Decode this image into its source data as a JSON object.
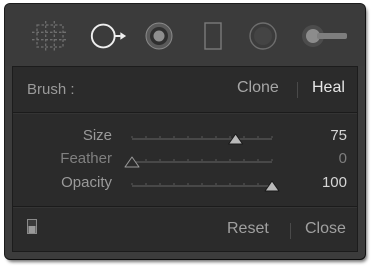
{
  "tools": [
    {
      "name": "crop-overlay",
      "icon": "crop-grid-icon",
      "active": false
    },
    {
      "name": "spot-removal",
      "icon": "spot-removal-icon",
      "active": true
    },
    {
      "name": "red-eye-correction",
      "icon": "red-eye-icon",
      "active": false
    },
    {
      "name": "graduated-filter",
      "icon": "graduated-filter-icon",
      "active": false
    },
    {
      "name": "radial-filter",
      "icon": "radial-filter-icon",
      "active": false
    },
    {
      "name": "adjustment-brush",
      "icon": "adjustment-brush-icon",
      "active": false
    }
  ],
  "brush": {
    "label": "Brush :",
    "options": [
      "Clone",
      "Heal"
    ],
    "selected": "Heal"
  },
  "sliders": [
    {
      "label": "Size",
      "value": "75",
      "level": 0.74,
      "enabled": true
    },
    {
      "label": "Feather",
      "value": "0",
      "level": 0.0,
      "enabled": false
    },
    {
      "label": "Opacity",
      "value": "100",
      "level": 1.0,
      "enabled": true
    }
  ],
  "footer": {
    "reset_label": "Reset",
    "close_label": "Close"
  },
  "colors": {
    "panel_bg": "#2b2b2b",
    "strip_bg": "#3b3b3b",
    "active_text": "#e6e6e6",
    "muted_text": "#9a9a9a"
  }
}
